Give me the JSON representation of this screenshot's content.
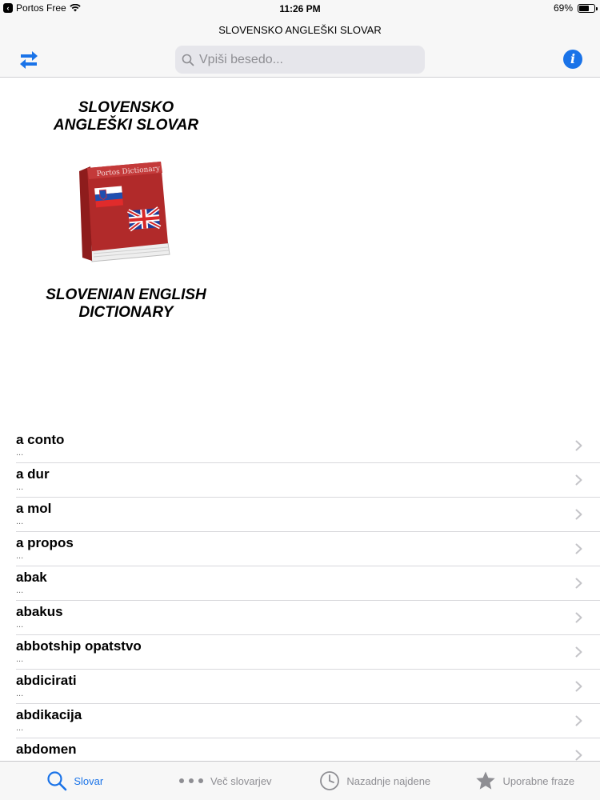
{
  "status": {
    "carrier": "Portos Free",
    "time": "11:26 PM",
    "battery": "69%",
    "battery_level": 0.69
  },
  "nav": {
    "title": "SLOVENSKO ANGLEŠKI SLOVAR",
    "search_placeholder": "Vpiši besedo...",
    "swap_icon": "swap-arrows-icon",
    "info_icon": "info-icon"
  },
  "hero": {
    "title_line1": "SLOVENSKO",
    "title_line2": "ANGLEŠKI SLOVAR",
    "book_label": "Portos Dictionary",
    "subtitle_line1": "SLOVENIAN ENGLISH",
    "subtitle_line2": "DICTIONARY"
  },
  "list": {
    "items": [
      {
        "word": "a conto",
        "sub": "..."
      },
      {
        "word": "a dur",
        "sub": "..."
      },
      {
        "word": "a mol",
        "sub": "..."
      },
      {
        "word": "a propos",
        "sub": "..."
      },
      {
        "word": "abak",
        "sub": "..."
      },
      {
        "word": "abakus",
        "sub": "..."
      },
      {
        "word": "abbotship opatstvo",
        "sub": "..."
      },
      {
        "word": "abdicirati",
        "sub": "..."
      },
      {
        "word": "abdikacija",
        "sub": "..."
      },
      {
        "word": "abdomen",
        "sub": "..."
      }
    ]
  },
  "tabs": [
    {
      "label": "Slovar",
      "icon": "search-icon",
      "active": true
    },
    {
      "label": "Več slovarjev",
      "icon": "more-dots-icon",
      "active": false
    },
    {
      "label": "Nazadnje najdene",
      "icon": "clock-icon",
      "active": false
    },
    {
      "label": "Uporabne fraze",
      "icon": "star-icon",
      "active": false
    }
  ],
  "colors": {
    "accent": "#1a73e8",
    "bar_bg": "#f7f7f7",
    "search_bg": "#e6e6eb"
  }
}
